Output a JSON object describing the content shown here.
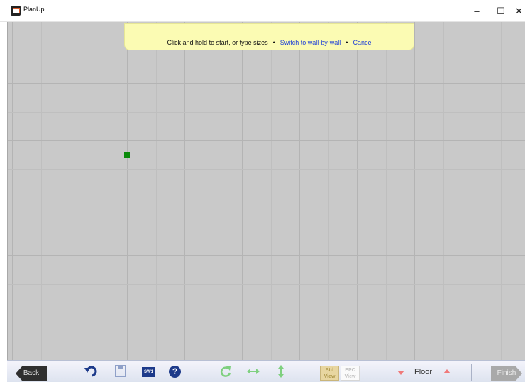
{
  "window": {
    "title": "PlanUp",
    "minimize_glyph": "–",
    "maximize_glyph": "☐",
    "close_glyph": "✕"
  },
  "banner": {
    "instruction": "Click and hold to start, or type sizes",
    "separator": "•",
    "switch_link": "Switch to wall-by-wall",
    "cancel_link": "Cancel"
  },
  "toolbar": {
    "back_label": "Back",
    "finish_label": "Finish",
    "sw1_label": "SW1",
    "help_glyph": "?",
    "std_view_line1": "Std",
    "std_view_line2": "View",
    "epc_view_line1": "EPC",
    "epc_view_line2": "View",
    "floor_label": "Floor",
    "icons": {
      "undo": "undo-icon",
      "save": "save-icon",
      "rotate": "rotate-icon",
      "flip_horizontal": "flip-horizontal-icon",
      "flip_vertical": "flip-vertical-icon"
    }
  },
  "colors": {
    "canvas_bg": "#c9c9c9",
    "banner_bg": "#fbfbb3",
    "link": "#1d3fd8",
    "marker": "#0a8a0a",
    "accent_blue": "#1d3a8a",
    "floor_arrows": "#f07a7a"
  }
}
